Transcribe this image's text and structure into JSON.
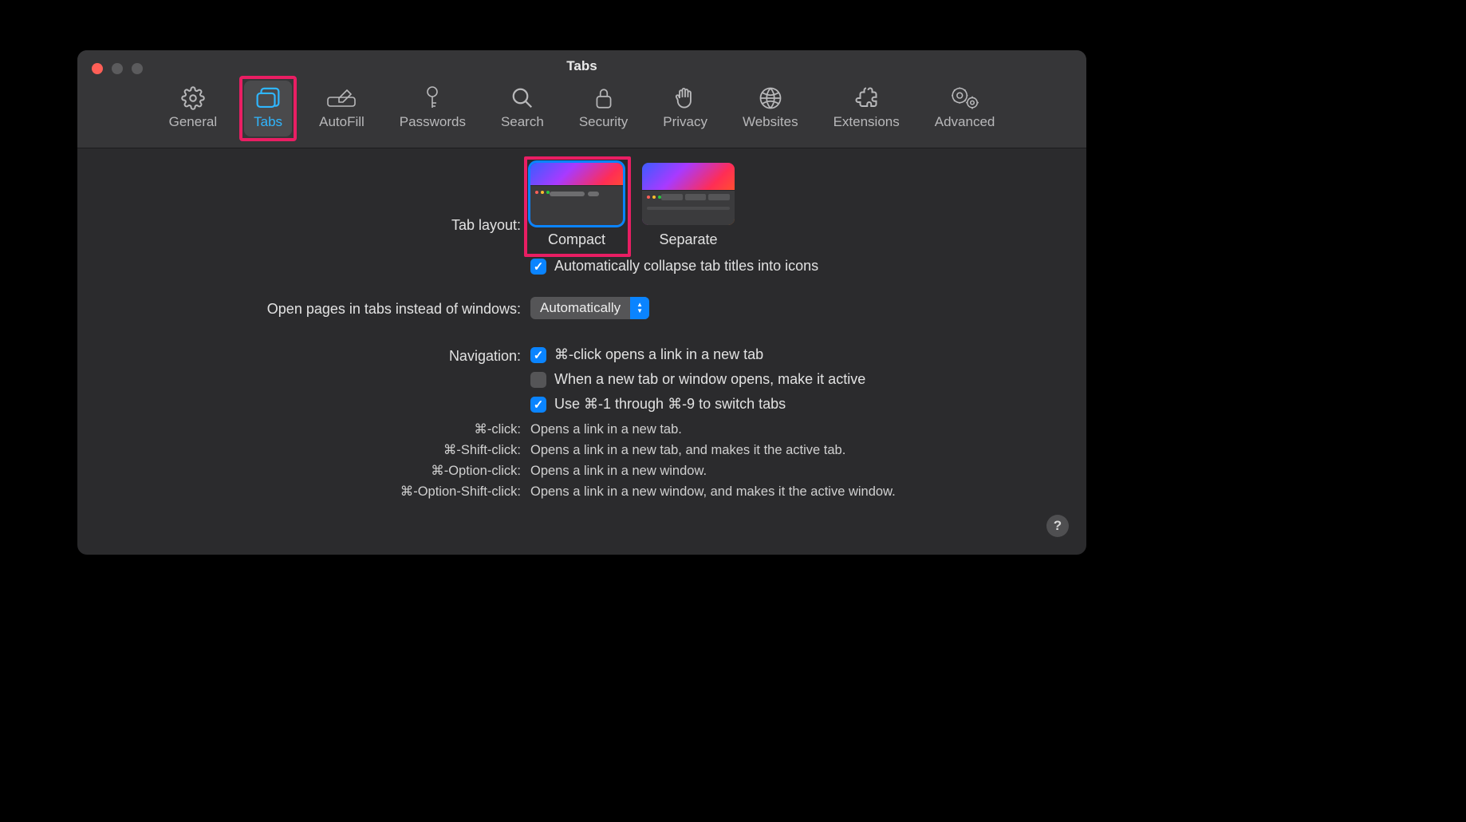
{
  "window": {
    "title": "Tabs"
  },
  "tabbar": [
    {
      "id": "general",
      "label": "General",
      "active": false
    },
    {
      "id": "tabs",
      "label": "Tabs",
      "active": true
    },
    {
      "id": "autofill",
      "label": "AutoFill",
      "active": false
    },
    {
      "id": "passwords",
      "label": "Passwords",
      "active": false
    },
    {
      "id": "search",
      "label": "Search",
      "active": false
    },
    {
      "id": "security",
      "label": "Security",
      "active": false
    },
    {
      "id": "privacy",
      "label": "Privacy",
      "active": false
    },
    {
      "id": "websites",
      "label": "Websites",
      "active": false
    },
    {
      "id": "extensions",
      "label": "Extensions",
      "active": false
    },
    {
      "id": "advanced",
      "label": "Advanced",
      "active": false
    }
  ],
  "labels": {
    "tab_layout": "Tab layout:",
    "open_pages": "Open pages in tabs instead of windows:",
    "navigation": "Navigation:"
  },
  "layout": {
    "compact": "Compact",
    "separate": "Separate",
    "selected": "compact",
    "auto_collapse": "Automatically collapse tab titles into icons",
    "auto_collapse_checked": true
  },
  "open_pages": {
    "value": "Automatically"
  },
  "navigation": {
    "cmd_click": {
      "label": "⌘-click opens a link in a new tab",
      "checked": true
    },
    "new_tab_active": {
      "label": "When a new tab or window opens, make it active",
      "checked": false
    },
    "cmd_num_switch": {
      "label": "Use ⌘-1 through ⌘-9 to switch tabs",
      "checked": true
    }
  },
  "help": [
    {
      "key": "⌘-click:",
      "val": "Opens a link in a new tab."
    },
    {
      "key": "⌘-Shift-click:",
      "val": "Opens a link in a new tab, and makes it the active tab."
    },
    {
      "key": "⌘-Option-click:",
      "val": "Opens a link in a new window."
    },
    {
      "key": "⌘-Option-Shift-click:",
      "val": "Opens a link in a new window, and makes it the active window."
    }
  ],
  "help_button": "?"
}
